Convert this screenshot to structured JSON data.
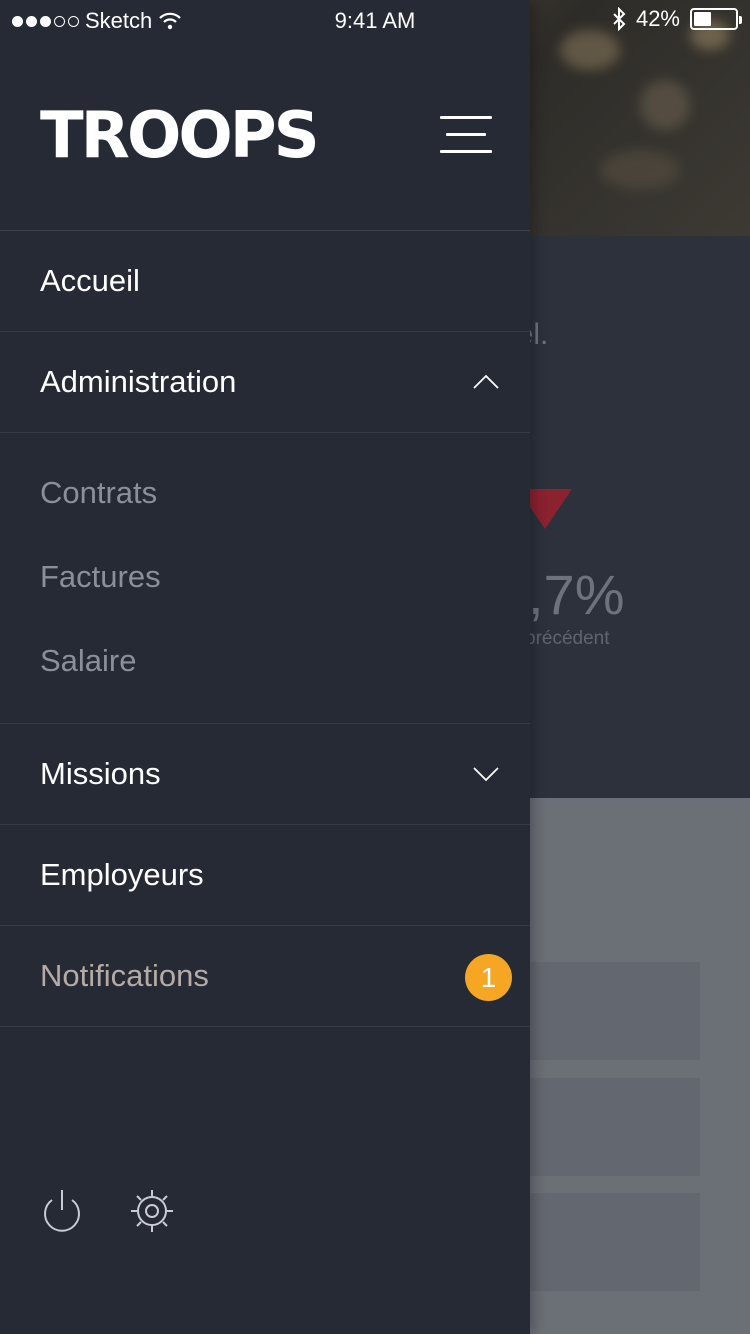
{
  "status_bar": {
    "signal_dots_filled": 3,
    "signal_dots_total": 5,
    "carrier": "Sketch",
    "time": "9:41 AM",
    "battery_percent_label": "42%",
    "battery_level": 0.42
  },
  "background": {
    "text_partial": "uel.",
    "percent_partial": ",7%",
    "caption_partial": "précédent",
    "accent_color": "#8a2230"
  },
  "drawer": {
    "logo_text": "TROOPS",
    "menu": [
      {
        "label": "Accueil"
      },
      {
        "label": "Administration",
        "expanded": true,
        "chevron": "chevron-up-icon",
        "children": [
          {
            "label": "Contrats"
          },
          {
            "label": "Factures"
          },
          {
            "label": "Salaire"
          }
        ]
      },
      {
        "label": "Missions",
        "expanded": false,
        "chevron": "chevron-down-icon"
      },
      {
        "label": "Employeurs"
      },
      {
        "label": "Notifications",
        "badge": "1",
        "badge_color": "#f5a623"
      }
    ],
    "bottom_icons": [
      "power-icon",
      "settings-icon"
    ]
  }
}
